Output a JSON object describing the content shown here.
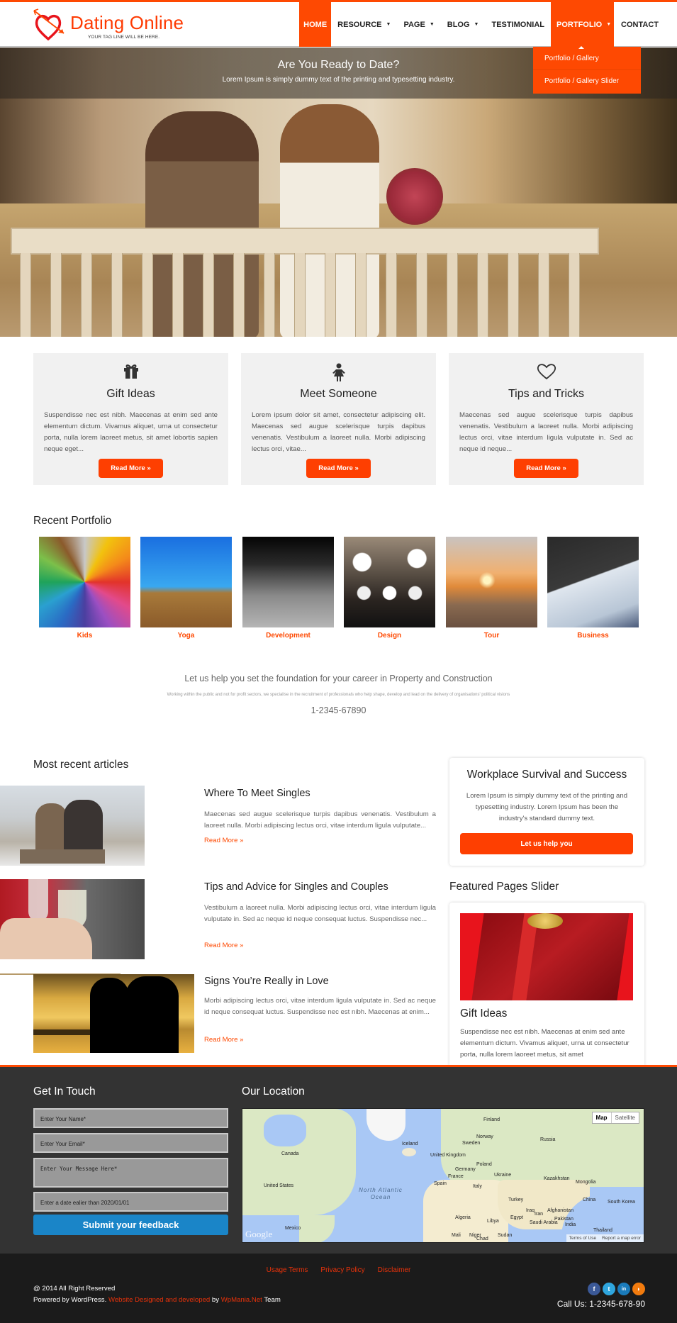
{
  "brand": {
    "title": "Dating Online",
    "tagline": "YOUR TAG LINE WILL BE HERE.",
    "accent_color": "#fe4902"
  },
  "nav": {
    "items": [
      {
        "label": "HOME",
        "active": true,
        "has_dropdown": false
      },
      {
        "label": "RESOURCE",
        "active": false,
        "has_dropdown": true
      },
      {
        "label": "PAGE",
        "active": false,
        "has_dropdown": true
      },
      {
        "label": "BLOG",
        "active": false,
        "has_dropdown": true
      },
      {
        "label": "TESTIMONIAL",
        "active": false,
        "has_dropdown": false
      },
      {
        "label": "PORTFOLIO",
        "active": true,
        "has_dropdown": true
      },
      {
        "label": "CONTACT",
        "active": false,
        "has_dropdown": false
      }
    ],
    "caret": "▼",
    "portfolio_dropdown": [
      "Portfolio / Gallery",
      "Portfolio / Gallery Slider"
    ]
  },
  "hero": {
    "title": "Are You Ready to Date?",
    "subtitle": "Lorem Ipsum is simply dummy text of the printing and typesetting industry."
  },
  "features": [
    {
      "icon": "gift-icon",
      "title": "Gift Ideas",
      "text": "Suspendisse nec est nibh. Maecenas at enim sed ante elementum dictum. Vivamus aliquet, urna ut consectetur porta, nulla lorem laoreet metus, sit amet lobortis sapien neque eget...",
      "button": "Read More »"
    },
    {
      "icon": "female-icon",
      "title": "Meet Someone",
      "text": "Lorem ipsum dolor sit amet, consectetur adipiscing elit. Maecenas sed augue scelerisque turpis dapibus venenatis. Vestibulum a laoreet nulla. Morbi adipiscing lectus orci, vitae...",
      "button": "Read More »"
    },
    {
      "icon": "heart-icon",
      "title": "Tips and Tricks",
      "text": "Maecenas sed augue scelerisque turpis dapibus venenatis. Vestibulum a laoreet nulla. Morbi adipiscing lectus orci, vitae interdum ligula vulputate in. Sed ac neque id neque...",
      "button": "Read More »"
    }
  ],
  "portfolio": {
    "heading": "Recent Portfolio",
    "items": [
      {
        "label": "Kids"
      },
      {
        "label": "Yoga"
      },
      {
        "label": "Development"
      },
      {
        "label": "Design"
      },
      {
        "label": "Tour"
      },
      {
        "label": "Business"
      }
    ]
  },
  "cta": {
    "heading": "Let us help you set the foundation for your career in Property and Construction",
    "text": "Working within the public and not for profit sectors, we specialise in the recruitment of professionals who help shape, develop and lead on the delivery of organisations' political visions",
    "phone": "1-2345-67890"
  },
  "articles": {
    "heading": "Most recent articles",
    "items": [
      {
        "title": "Where To Meet Singles",
        "text": "Maecenas sed augue scelerisque turpis dapibus venenatis. Vestibulum a laoreet nulla. Morbi adipiscing lectus orci, vitae interdum ligula vulputate...",
        "more": "Read More »"
      },
      {
        "title": "Tips and Advice for Singles and Couples",
        "text": "Vestibulum a laoreet nulla. Morbi adipiscing lectus orci, vitae interdum ligula vulputate in. Sed ac neque id neque consequat luctus. Suspendisse nec...",
        "more": "Read More »"
      },
      {
        "title": "Signs You’re Really in Love",
        "text": "Morbi adipiscing lectus orci, vitae interdum ligula vulputate in. Sed ac neque id neque consequat luctus. Suspendisse nec est nibh. Maecenas at enim...",
        "more": "Read More »"
      }
    ]
  },
  "sidebar": {
    "card": {
      "title": "Workplace Survival and Success",
      "text": "Lorem Ipsum is simply dummy text of the printing and typesetting industry. Lorem Ipsum has been the industry's standard dummy text.",
      "button": "Let us help you"
    },
    "slider": {
      "heading": "Featured Pages Slider",
      "title": "Gift Ideas",
      "text": "Suspendisse nec est nibh. Maecenas at enim sed ante elementum dictum. Vivamus aliquet, urna ut consectetur porta, nulla lorem laoreet metus, sit amet"
    }
  },
  "footer": {
    "contact": {
      "heading": "Get In Touch",
      "name_placeholder": "Enter Your Name*",
      "email_placeholder": "Enter Your Email*",
      "message_placeholder": "Enter Your Message Here*",
      "date_placeholder": "Enter a date ealier than 2020/01/01",
      "submit": "Submit your feedback"
    },
    "location": {
      "heading": "Our Location",
      "map_button": "Map",
      "satellite_button": "Satellite",
      "google": "Google",
      "terms": "Terms of Use",
      "report": "Report a map error",
      "labels": [
        "Canada",
        "United States",
        "Mexico",
        "Iceland",
        "United Kingdom",
        "France",
        "Spain",
        "Germany",
        "Norway",
        "Sweden",
        "Finland",
        "Poland",
        "Ukraine",
        "Italy",
        "Turkey",
        "Russia",
        "Kazakhstan",
        "Mongolia",
        "China",
        "South Korea",
        "Afghanistan",
        "Pakistan",
        "Iran",
        "Iraq",
        "Saudi Arabia",
        "India",
        "Thailand",
        "Egypt",
        "Libya",
        "Algeria",
        "Mali",
        "Niger",
        "Chad",
        "Sudan"
      ],
      "ocean": "North Atlantic Ocean"
    },
    "links": [
      "Usage Terms",
      "Privacy Policy",
      "Disclaimer"
    ],
    "copyright": "@ 2014 All Right Reserved",
    "powered_prefix": "Powered by WordPress.",
    "powered_link": "Website Designed and developed",
    "powered_by": "by",
    "powered_company": "WpMania.Net",
    "powered_suffix": "Team",
    "social": [
      {
        "name": "facebook",
        "glyph": "f",
        "color": "#3b5998"
      },
      {
        "name": "twitter",
        "glyph": "t",
        "color": "#2fa6de"
      },
      {
        "name": "linkedin",
        "glyph": "in",
        "color": "#1a7bbb"
      },
      {
        "name": "rss",
        "glyph": "◗",
        "color": "#f27b0e"
      }
    ],
    "call": "Call Us: 1-2345-678-90"
  }
}
